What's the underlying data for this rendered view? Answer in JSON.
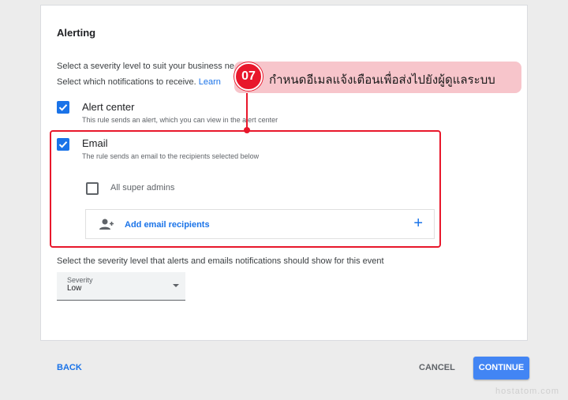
{
  "alerting": {
    "title": "Alerting",
    "desc_severity": "Select a severity level to suit your business ne",
    "desc_notifications": "Select which notifications to receive.",
    "learn_more": "Learn"
  },
  "options": {
    "alert_center": {
      "label": "Alert center",
      "sub": "This rule sends an alert, which you can view in the alert center",
      "checked": true
    },
    "email": {
      "label": "Email",
      "sub": "The rule sends an email to the recipients selected below",
      "checked": true
    },
    "super_admins": {
      "label": "All super admins",
      "checked": false
    }
  },
  "recipients": {
    "add_label": "Add email recipients",
    "add_icon": "plus-icon",
    "person_icon": "person-add-icon"
  },
  "severity": {
    "description": "Select the severity level that alerts and emails notifications should show for this event",
    "select_label": "Severity",
    "select_value": "Low"
  },
  "callout": {
    "number": "07",
    "text": "กำหนดอีเมลแจ้งเตือนเพื่อส่งไปยังผู้ดูแลระบบ",
    "color": "#e8172b",
    "bg": "#f7c5cb"
  },
  "footer": {
    "back": "BACK",
    "cancel": "CANCEL",
    "continue": "CONTINUE"
  },
  "watermark": "hostatom.com",
  "colors": {
    "accent": "#1a73e8",
    "primary_button": "#4285f4"
  }
}
